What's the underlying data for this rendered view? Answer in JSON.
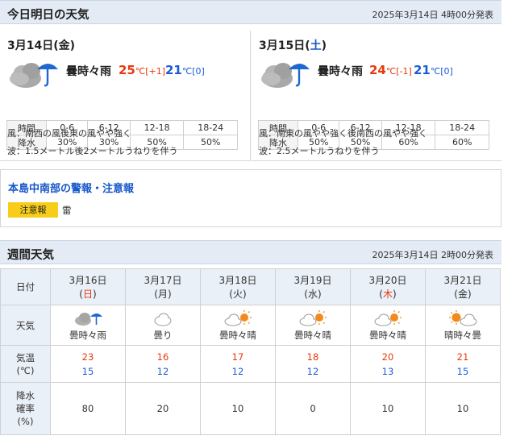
{
  "today_section": {
    "title": "今日明日の天気",
    "issued": "2025年3月14日 4時00分発表"
  },
  "days": [
    {
      "date_prefix": "3月14日(",
      "dow": "金",
      "date_suffix": ")",
      "weather": "曇時々雨",
      "temp_high": "25",
      "temp_high_unit": "℃[+1]",
      "temp_low": "21",
      "temp_low_unit": "℃[0]",
      "icon": "cloud-rain-icon",
      "rain_header": "時間",
      "rain_label": "降水",
      "periods": [
        "0-6",
        "6-12",
        "12-18",
        "18-24"
      ],
      "pop": [
        "30%",
        "30%",
        "50%",
        "50%"
      ],
      "wind": "風：南西の風後東の風やや強く",
      "wave": "波：1.5メートル後2メートルうねりを伴う"
    },
    {
      "date_prefix": "3月15日(",
      "dow": "土",
      "date_suffix": ")",
      "weather": "曇時々雨",
      "temp_high": "24",
      "temp_high_unit": "℃[-1]",
      "temp_low": "21",
      "temp_low_unit": "℃[0]",
      "icon": "cloud-rain-icon",
      "rain_header": "時間",
      "rain_label": "降水",
      "periods": [
        "0-6",
        "6-12",
        "12-18",
        "18-24"
      ],
      "pop": [
        "50%",
        "50%",
        "60%",
        "60%"
      ],
      "wind": "風：南東の風やや強く後南西の風やや強く",
      "wave": "波：2.5メートルうねりを伴う"
    }
  ],
  "warning": {
    "title": "本島中南部の警報・注意報",
    "badge": "注意報",
    "item": "雷"
  },
  "weekly_section": {
    "title": "週間天気",
    "issued": "2025年3月14日 2時00分発表"
  },
  "weekly": {
    "row_labels": {
      "date": "日付",
      "weather": "天気",
      "temp_line1": "気温",
      "temp_line2": "(℃)",
      "pop_line1": "降水",
      "pop_line2": "確率",
      "pop_line3": "(%)"
    },
    "days": [
      {
        "date": "3月16日",
        "dow": "日",
        "dow_color": "#e8380d",
        "weather": "曇時々雨",
        "icon": "cloud-rain-icon",
        "high": "23",
        "low": "15",
        "pop": "80"
      },
      {
        "date": "3月17日",
        "dow": "月",
        "dow_color": "#333333",
        "weather": "曇り",
        "icon": "cloud-icon",
        "high": "16",
        "low": "12",
        "pop": "20"
      },
      {
        "date": "3月18日",
        "dow": "火",
        "dow_color": "#333333",
        "weather": "曇時々晴",
        "icon": "cloud-sun-icon",
        "high": "17",
        "low": "12",
        "pop": "10"
      },
      {
        "date": "3月19日",
        "dow": "水",
        "dow_color": "#333333",
        "weather": "曇時々晴",
        "icon": "cloud-sun-icon",
        "high": "18",
        "low": "12",
        "pop": "0"
      },
      {
        "date": "3月20日",
        "dow": "木",
        "dow_color": "#e8380d",
        "weather": "曇時々晴",
        "icon": "cloud-sun-icon",
        "high": "20",
        "low": "13",
        "pop": "10"
      },
      {
        "date": "3月21日",
        "dow": "金",
        "dow_color": "#333333",
        "weather": "晴時々曇",
        "icon": "sun-cloud-icon",
        "high": "21",
        "low": "15",
        "pop": "10"
      }
    ]
  },
  "colors": {
    "accent_blue": "#1556c9",
    "high_temp": "#e8380d",
    "low_temp": "#1a5bd8",
    "header_bg": "#e4ebf5",
    "warning_badge": "#f7cd1a"
  }
}
